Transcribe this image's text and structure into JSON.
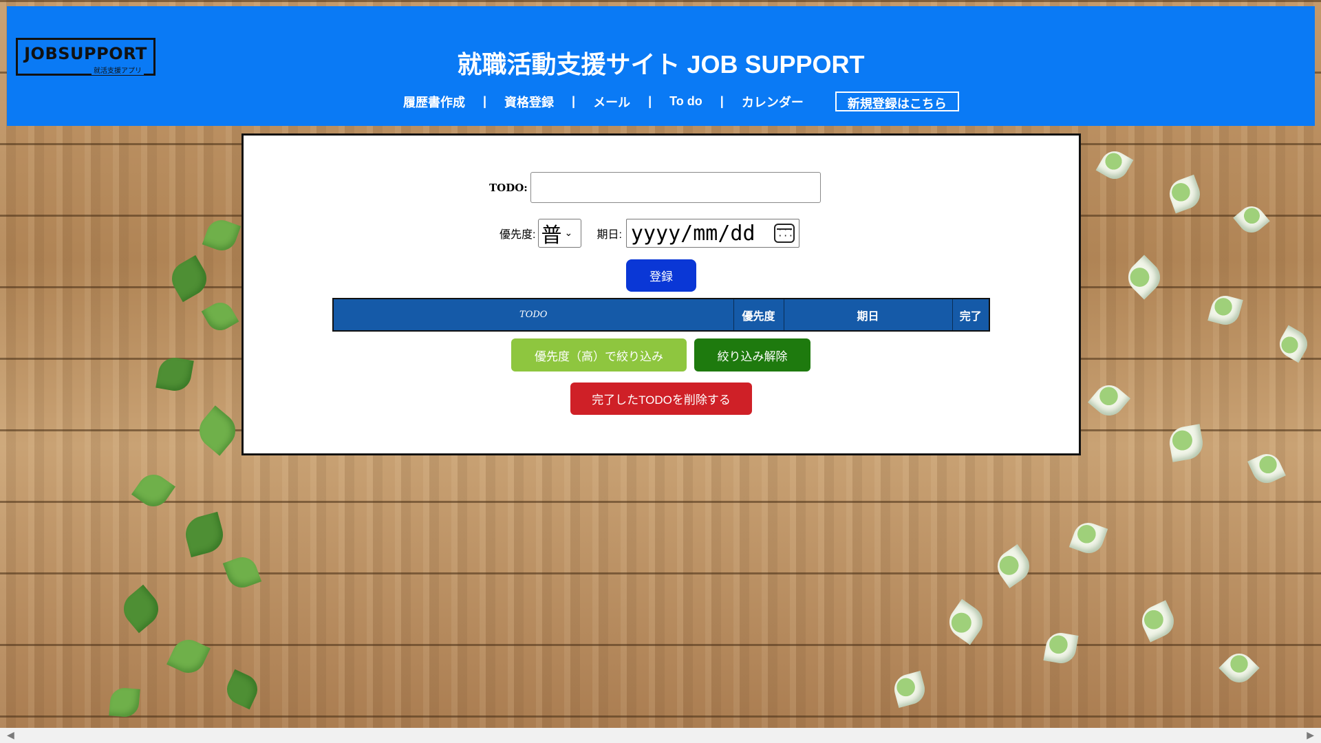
{
  "header": {
    "logo": {
      "main": "JOBSUPPORT",
      "sub": "就活支援アプリ"
    },
    "title": "就職活動支援サイト JOB SUPPORT",
    "nav": {
      "items": [
        "履歴書作成",
        "資格登録",
        "メール",
        "To do",
        "カレンダー"
      ],
      "separator": "|",
      "register_label": "新規登録はこちら"
    }
  },
  "form": {
    "todo_label": "TODO:",
    "todo_value": "",
    "priority_label": "優先度:",
    "priority_selected": "普",
    "due_label": "期日:",
    "due_placeholder": "yyyy/mm/dd",
    "register_button": "登録"
  },
  "table": {
    "headers": [
      "TODO",
      "優先度",
      "期日",
      "完了"
    ]
  },
  "actions": {
    "filter_high": "優先度（高）で絞り込み",
    "clear_filter": "絞り込み解除",
    "delete_done": "完了したTODOを削除する"
  },
  "colors": {
    "header_bg": "#0a7af5",
    "register_btn": "#0a37d6",
    "table_header": "#155aa8",
    "filter_high_btn": "#8ec63f",
    "clear_filter_btn": "#1e7a0e",
    "delete_btn": "#cf2027"
  },
  "icons": {
    "calendar": "calendar-icon",
    "chevron": "chevron-down-icon",
    "scroll_left": "scroll-left-arrow-icon",
    "scroll_right": "scroll-right-arrow-icon"
  }
}
